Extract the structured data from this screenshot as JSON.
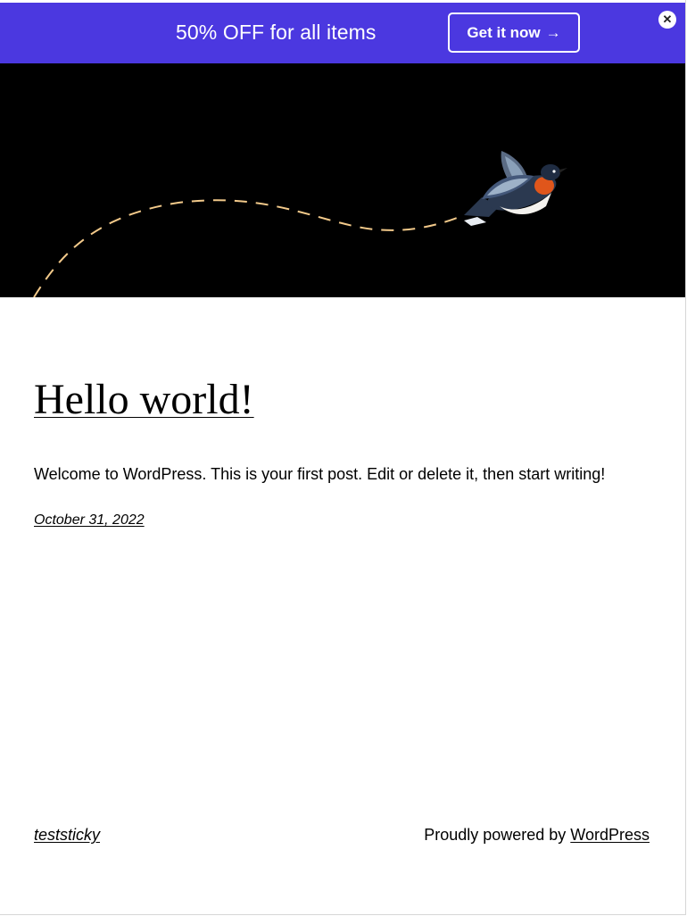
{
  "promo": {
    "text": "50% OFF for all items",
    "cta_label": "Get it now",
    "cta_arrow": "→",
    "close_glyph": "✕"
  },
  "hero": {
    "image": "bird-flight-illustration",
    "path_color": "#f2c98a"
  },
  "post": {
    "title": "Hello world!",
    "excerpt": "Welcome to WordPress. This is your first post. Edit or delete it, then start writing!",
    "date": "October 31, 2022"
  },
  "footer": {
    "site_title": "teststicky",
    "credit_prefix": "Proudly powered by ",
    "credit_link": "WordPress"
  },
  "colors": {
    "promo_bg": "#4b38e0",
    "hero_bg": "#000000"
  }
}
